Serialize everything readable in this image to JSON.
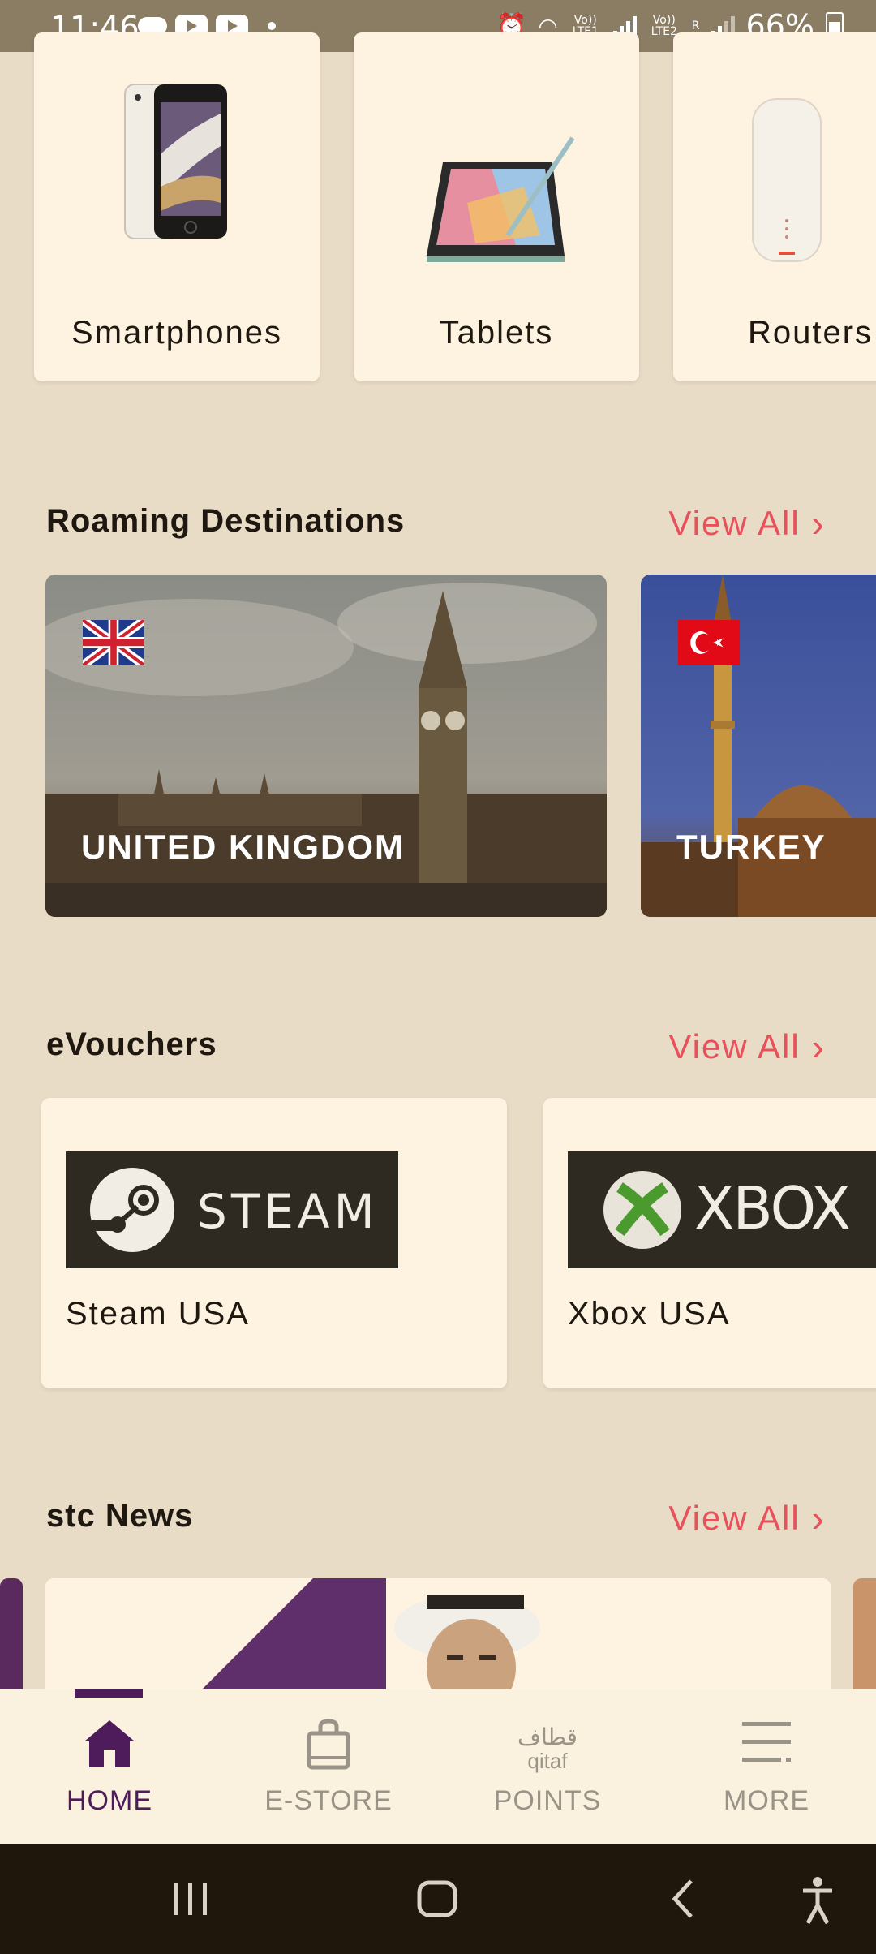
{
  "status_bar": {
    "time": "11:46",
    "net1": "Vo)) LTE1",
    "net2": "Vo)) LTE2",
    "roaming": "R",
    "battery": "66%"
  },
  "categories": [
    {
      "label": "Smartphones",
      "icon": "smartphone"
    },
    {
      "label": "Tablets",
      "icon": "tablet"
    },
    {
      "label": "Routers",
      "icon": "router"
    }
  ],
  "roaming": {
    "title": "Roaming Destinations",
    "view_all": "View All",
    "destinations": [
      {
        "name": "UNITED KINGDOM",
        "flag": "uk-flag"
      },
      {
        "name": "TURKEY",
        "flag": "turkey-flag"
      }
    ]
  },
  "evouchers": {
    "title": "eVouchers",
    "view_all": "View All",
    "items": [
      {
        "name": "Steam USA",
        "logo_text": "STEAM"
      },
      {
        "name": "Xbox USA",
        "logo_text": "XBOX"
      }
    ]
  },
  "news": {
    "title": "stc News",
    "view_all": "View All"
  },
  "bottom_nav": {
    "items": [
      {
        "label": "HOME",
        "active": true
      },
      {
        "label": "E-STORE"
      },
      {
        "label": "POINTS",
        "brand_ar": "قطاف",
        "brand_en": "qitaf"
      },
      {
        "label": "MORE"
      }
    ]
  },
  "colors": {
    "accent": "#e8505b",
    "primary": "#4f1c5b",
    "background": "#e9dcc6",
    "card": "#fdf3e0"
  }
}
